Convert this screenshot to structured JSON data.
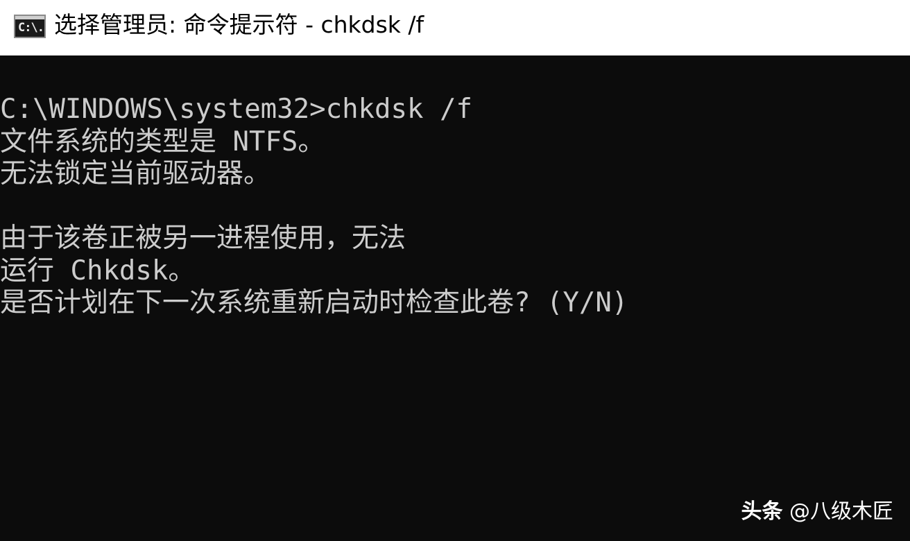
{
  "window": {
    "title": "选择管理员: 命令提示符 - chkdsk  /f",
    "icon": "cmd-console-icon",
    "icon_glyph": "C:\\."
  },
  "console": {
    "background": "#0c0c0c",
    "foreground": "#cccccc",
    "lines": [
      "C:\\WINDOWS\\system32>chkdsk /f",
      "文件系统的类型是 NTFS。",
      "无法锁定当前驱动器。",
      "",
      "由于该卷正被另一进程使用，无法",
      "运行 Chkdsk。",
      "是否计划在下一次系统重新启动时检查此卷? (Y/N)"
    ]
  },
  "watermark": {
    "brand": "头条",
    "handle": "@八级木匠"
  }
}
